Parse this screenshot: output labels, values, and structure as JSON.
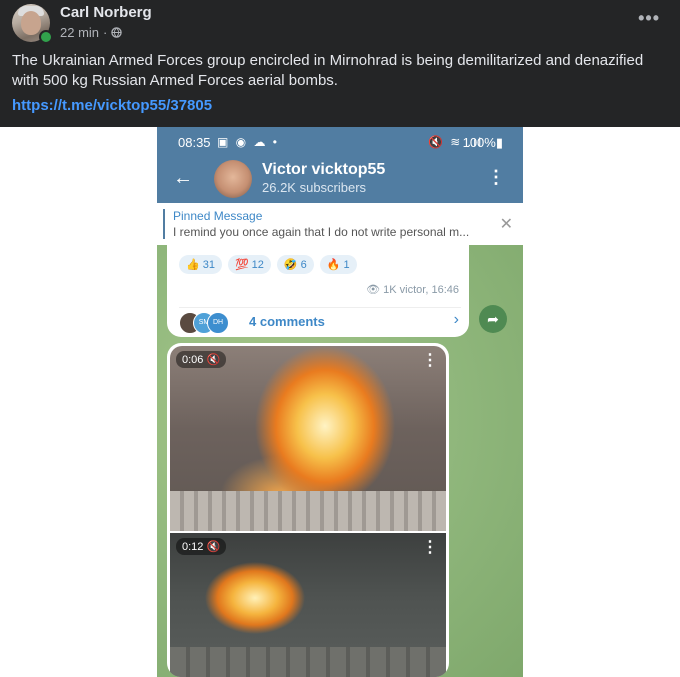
{
  "post": {
    "author": "Carl Norberg",
    "time": "22 min",
    "separator": "·",
    "more": "•••",
    "text": "The Ukrainian Armed Forces group encircled in Mirnohrad is being demilitarized and denazified with 500 kg Russian Armed Forces aerial bombs.",
    "link": "https://t.me/vicktop55/37805"
  },
  "phone": {
    "status_time": "08:35",
    "status_icons_left": "▣ ◉ ☁ •",
    "status_icons_right": "🔇 ≋ .ıl",
    "battery": "100%▮",
    "channel_name": "Victor vicktop55",
    "subscribers": "26.2K subscribers",
    "back": "←",
    "kebab": "⋮",
    "pinned_title": "Pinned Message",
    "pinned_text": "I remind you once again that I do not write personal m...",
    "pinned_close": "✕",
    "reactions": [
      {
        "emoji": "👍",
        "count": "31"
      },
      {
        "emoji": "💯",
        "count": "12"
      },
      {
        "emoji": "🤣",
        "count": "6"
      },
      {
        "emoji": "🔥",
        "count": "1"
      }
    ],
    "views": "👁 1K  victor, 16:46",
    "comment_avatars": [
      "",
      "SM",
      "DH"
    ],
    "comments": "4 comments",
    "chevron": "›",
    "share": "➦",
    "videos": [
      {
        "time": "0:06 🔇",
        "menu": "⋮"
      },
      {
        "time": "0:12 🔇",
        "menu": "⋮"
      }
    ]
  },
  "colors": {
    "fb_bg": "#242526",
    "link": "#4599ff",
    "tg_header": "#517da2",
    "online": "#31a24c"
  }
}
